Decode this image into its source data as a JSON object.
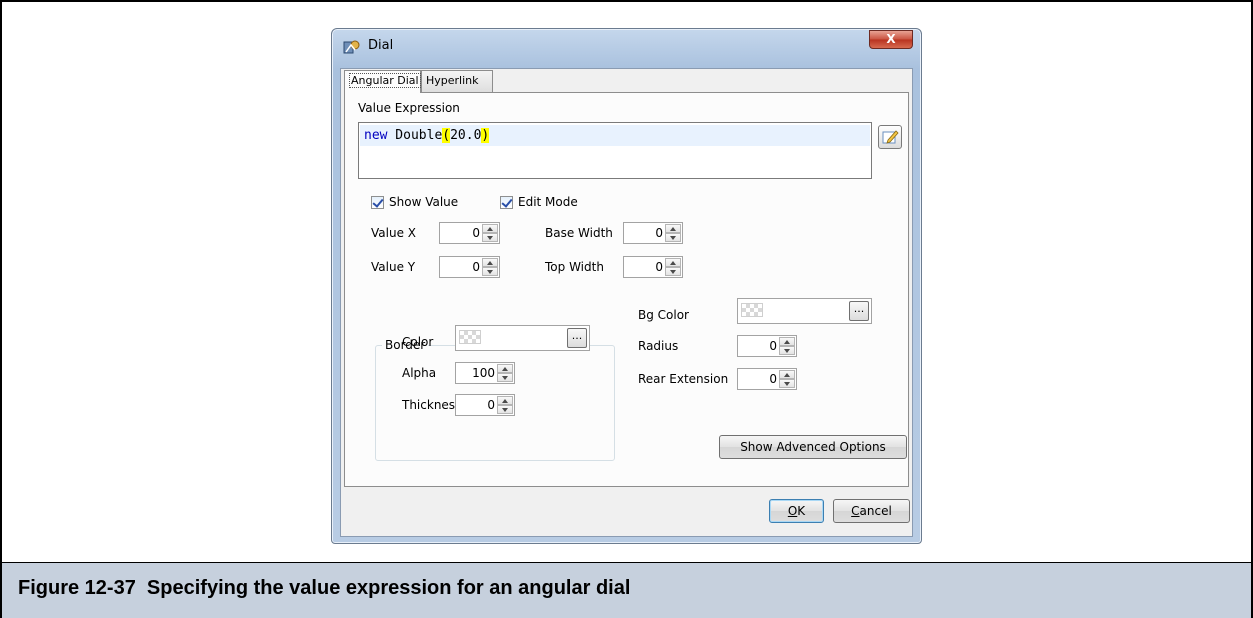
{
  "window": {
    "title": "Dial",
    "close_label": "X"
  },
  "tabs": [
    {
      "label": "Angular Dial",
      "active": true
    },
    {
      "label": "Hyperlink",
      "active": false
    }
  ],
  "expression": {
    "label": "Value Expression",
    "keyword": "new",
    "class_name": " Double",
    "open_paren": "(",
    "argument": "20.0",
    "close_paren": ")"
  },
  "checkboxes": {
    "show_value": {
      "label": "Show Value",
      "checked": true
    },
    "edit_mode": {
      "label": "Edit Mode",
      "checked": true
    }
  },
  "fields": {
    "value_x": {
      "label": "Value X",
      "value": "0"
    },
    "value_y": {
      "label": "Value Y",
      "value": "0"
    },
    "base_width": {
      "label": "Base Width",
      "value": "0"
    },
    "top_width": {
      "label": "Top Width",
      "value": "0"
    },
    "radius": {
      "label": "Radius",
      "value": "0"
    },
    "rear_extension": {
      "label": "Rear Extension",
      "value": "0"
    },
    "bg_color": {
      "label": "Bg Color",
      "button": "..."
    }
  },
  "border": {
    "title": "Border",
    "color": {
      "label": "Color",
      "button": "..."
    },
    "alpha": {
      "label": "Alpha",
      "value": "100"
    },
    "thickness": {
      "label": "Thickness",
      "value": "0"
    }
  },
  "buttons": {
    "advanced": "Show Advenced Options",
    "ok_first": "O",
    "ok_rest": "K",
    "cancel_first": "C",
    "cancel_rest": "ancel"
  },
  "caption": "Figure 12-37  Specifying the value expression for an angular dial",
  "colors": {
    "caption_bg": "#c6d0dd",
    "keyword": "#0000c0",
    "highlight": "#ffff00",
    "close_button": "#c9523f"
  }
}
